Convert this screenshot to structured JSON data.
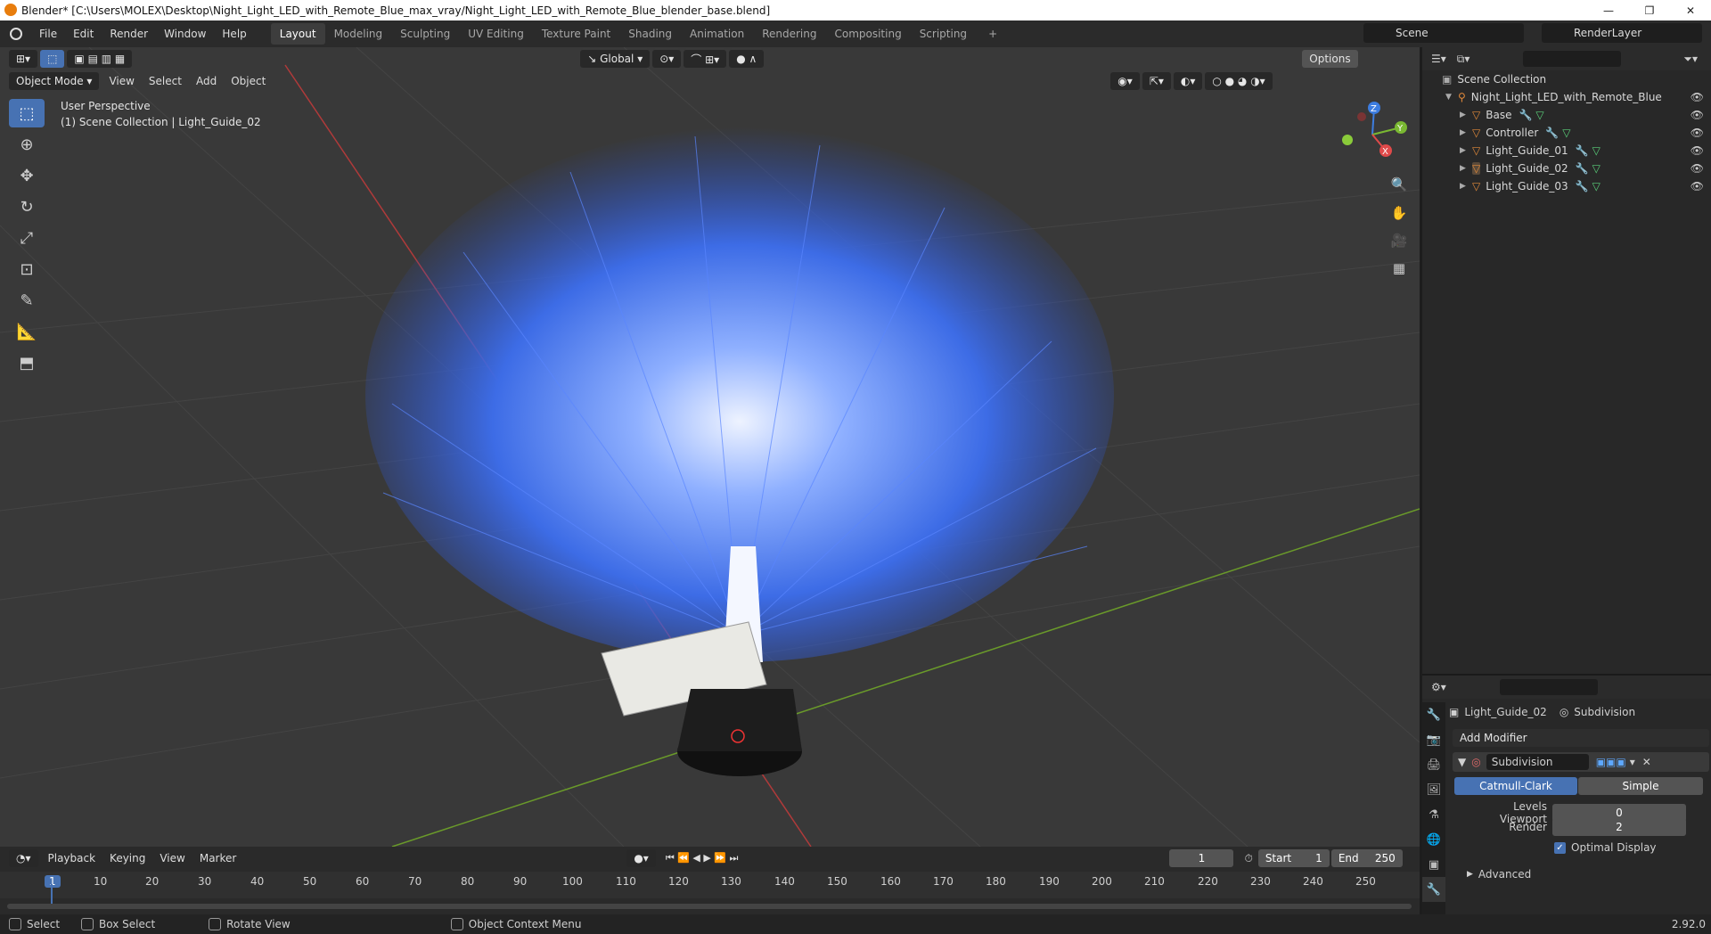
{
  "window": {
    "title": "Blender* [C:\\Users\\MOLEX\\Desktop\\Night_Light_LED_with_Remote_Blue_max_vray/Night_Light_LED_with_Remote_Blue_blender_base.blend]",
    "min": "—",
    "max": "❐",
    "close": "✕"
  },
  "menu": [
    "File",
    "Edit",
    "Render",
    "Window",
    "Help"
  ],
  "workspaces": [
    "Layout",
    "Modeling",
    "Sculpting",
    "UV Editing",
    "Texture Paint",
    "Shading",
    "Animation",
    "Rendering",
    "Compositing",
    "Scripting"
  ],
  "active_workspace": "Layout",
  "scene": "Scene",
  "render_layer": "RenderLayer",
  "viewport": {
    "orientation": "Global",
    "options_label": "Options",
    "mode": "Object Mode",
    "menus": [
      "View",
      "Select",
      "Add",
      "Object"
    ],
    "overlay_line1": "User Perspective",
    "overlay_line2": "(1) Scene Collection | Light_Guide_02",
    "gizmo_x": "X",
    "gizmo_y": "Y",
    "gizmo_z": "Z"
  },
  "outliner": {
    "root": "Scene Collection",
    "collection": "Night_Light_LED_with_Remote_Blue",
    "objects": [
      "Base",
      "Controller",
      "Light_Guide_01",
      "Light_Guide_02",
      "Light_Guide_03"
    ]
  },
  "properties": {
    "object": "Light_Guide_02",
    "modifier_context": "Subdivision",
    "add_modifier": "Add Modifier",
    "modifier_name": "Subdivision",
    "mode_a": "Catmull-Clark",
    "mode_b": "Simple",
    "levels_label": "Levels Viewport",
    "levels_value": "0",
    "render_label": "Render",
    "render_value": "2",
    "optimal_label": "Optimal Display",
    "advanced_label": "Advanced"
  },
  "timeline": {
    "menus": [
      "Playback",
      "Keying",
      "View",
      "Marker"
    ],
    "current_frame": "1",
    "start_label": "Start",
    "start": "1",
    "end_label": "End",
    "end": "250",
    "ticks": [
      "1",
      "10",
      "20",
      "30",
      "40",
      "50",
      "60",
      "70",
      "80",
      "90",
      "100",
      "110",
      "120",
      "130",
      "140",
      "150",
      "160",
      "170",
      "180",
      "190",
      "200",
      "210",
      "220",
      "230",
      "240",
      "250"
    ]
  },
  "status": {
    "select": "Select",
    "box_select": "Box Select",
    "rotate": "Rotate View",
    "context": "Object Context Menu",
    "version": "2.92.0"
  }
}
